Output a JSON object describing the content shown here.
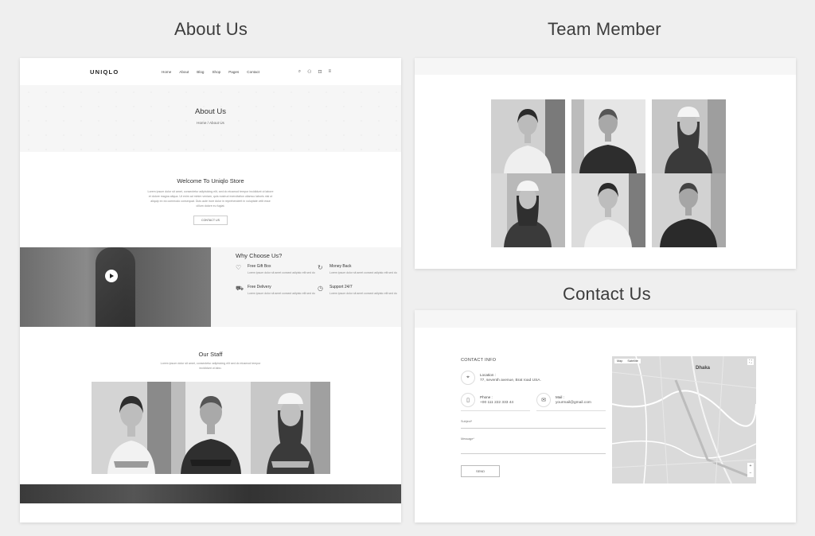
{
  "headings": {
    "about": "About Us",
    "team": "Team Member",
    "contact": "Contact Us"
  },
  "about_page": {
    "logo": "UNIQLO",
    "menu": [
      "Home",
      "About",
      "Blog",
      "Shop",
      "Pages",
      "Contact"
    ],
    "hero_title": "About Us",
    "breadcrumb": "Home  /  About Us",
    "welcome_title": "Welcome To Uniqlo Store",
    "welcome_text": "Lorem ipsum dolor sit amet, consectetur adipisicing elit, sed do eiusmod tempor incididunt ut labore et dolore magna aliqua. Ut enim ad minim veniam, quis nostrud exercitation ullamco laboris nisi ut aliquip ex ea commodo consequat. Duis aute irure dolor in reprehenderit in voluptate velit esse cillum dolore eu fugiat.",
    "welcome_button": "CONTACT US",
    "why_title": "Why Choose Us?",
    "features": [
      {
        "icon": "heart-icon",
        "glyph": "♡",
        "title": "Free Gift Box",
        "desc": "Lorem ipsum dolor sit amet consect adipisic elit sed do"
      },
      {
        "icon": "refresh-icon",
        "glyph": "↻",
        "title": "Money Back",
        "desc": "Lorem ipsum dolor sit amet consect adipisic elit sed do"
      },
      {
        "icon": "truck-icon",
        "glyph": "⛟",
        "title": "Free Delivery",
        "desc": "Lorem ipsum dolor sit amet consect adipisic elit sed do"
      },
      {
        "icon": "clock-icon",
        "glyph": "◷",
        "title": "Support 24/7",
        "desc": "Lorem ipsum dolor sit amet consect adipisic elit sed do"
      }
    ],
    "staff_title": "Our Staff",
    "staff_text": "Lorem ipsum dolor sit amet, consectetur adipisicing elit sed do eiusmod tempor incididunt ut labo."
  },
  "contact_page": {
    "info_title": "CONTACT INFO",
    "location_label": "Location :",
    "location_value": "77, seventh avenue, Brat road USA.",
    "phone_label": "Phone :",
    "phone_value": "+00 111 222 333 44",
    "mail_label": "Mail :",
    "mail_value": "yourmail@gmail.com",
    "subject_label": "Subject*",
    "message_label": "Message*",
    "send_label": "SEND",
    "map_tabs": [
      "Map",
      "Satellite"
    ],
    "map_city": "Dhaka"
  }
}
